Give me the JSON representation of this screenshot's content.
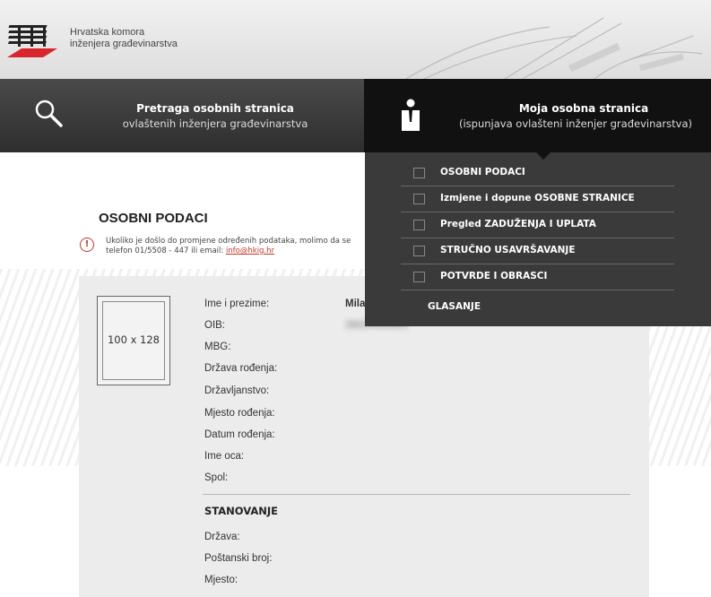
{
  "header": {
    "org_line1": "Hrvatska komora",
    "org_line2": "inženjera građevinarstva"
  },
  "nav": {
    "search_title": "Pretraga osobnih stranica",
    "search_subtitle": "ovlaštenih inženjera građevinarstva",
    "my_title": "Moja osobna stranica",
    "my_subtitle": "(ispunjava ovlašteni inženjer građevinarstva)"
  },
  "menu": {
    "items": [
      {
        "label": "OSOBNI PODACI"
      },
      {
        "label": "Izmjene i dopune OSOBNE STRANICE"
      },
      {
        "label": "Pregled ZADUŽENJA I UPLATA"
      },
      {
        "label": "STRUČNO USAVRŠAVANJE"
      },
      {
        "label": "POTVRDE I OBRASCI"
      }
    ],
    "last": "GLASANJE"
  },
  "page": {
    "title": "OSOBNI PODACI",
    "notice_line1": "Ukoliko je došlo do promjene određenih podataka, molimo da se",
    "notice_line2_prefix": "telefon 01/5508 - 447 ili email: ",
    "notice_email": "info@hkig.hr"
  },
  "photo": {
    "placeholder": "100 x 128"
  },
  "fields": [
    {
      "label": "Ime i prezime:",
      "value": "Mila"
    },
    {
      "label": "OIB:",
      "value": "26020000925"
    },
    {
      "label": "MBG:",
      "value": ""
    },
    {
      "label": "Država rođenja:",
      "value": ""
    },
    {
      "label": "Državljanstvo:",
      "value": ""
    },
    {
      "label": "Mjesto rođenja:",
      "value": ""
    },
    {
      "label": "Datum rođenja:",
      "value": ""
    },
    {
      "label": "Ime oca:",
      "value": ""
    },
    {
      "label": "Spol:",
      "value": ""
    }
  ],
  "stanovanje": {
    "title": "STANOVANJE",
    "fields": [
      {
        "label": "Država:",
        "value": ""
      },
      {
        "label": "Poštanski broj:",
        "value": ""
      },
      {
        "label": "Mjesto:",
        "value": ""
      }
    ]
  }
}
